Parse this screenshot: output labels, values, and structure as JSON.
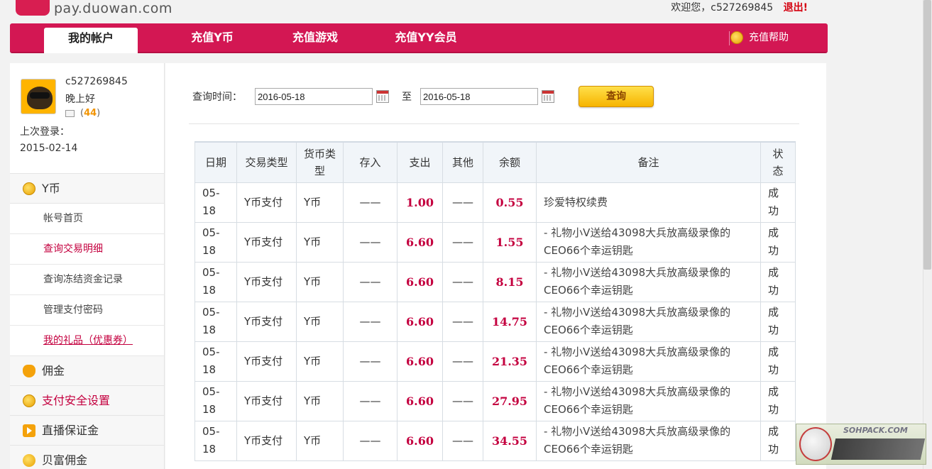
{
  "header": {
    "site": "pay.duowan.com",
    "welcome": "欢迎您，c527269845",
    "logout": "退出!"
  },
  "nav": {
    "tabs": [
      "我的帐户",
      "充值Y币",
      "充值游戏",
      "充值YY会员"
    ],
    "help": "充值帮助"
  },
  "profile": {
    "username": "c527269845",
    "greeting": "晚上好",
    "mail_prefix": "(",
    "mail_count": "44",
    "mail_suffix": ")",
    "last_login_label": "上次登录：",
    "last_login_date": "2015-02-14"
  },
  "sidebar": {
    "group_ycoin": "Y币",
    "items": [
      "帐号首页",
      "查询交易明细",
      "查询冻结资金记录",
      "管理支付密码",
      "我的礼品（优惠券）"
    ],
    "group_commission": "佣金",
    "group_security": "支付安全设置",
    "group_deposit": "直播保证金",
    "group_beifu": "贝富佣金"
  },
  "query": {
    "label": "查询时间：",
    "start_date": "2016-05-18",
    "to": "至",
    "end_date": "2016-05-18",
    "button": "查询"
  },
  "table": {
    "headers": [
      "日期",
      "交易类型",
      "货币类型",
      "存入",
      "支出",
      "其他",
      "余额",
      "备注",
      "状态"
    ],
    "rows": [
      {
        "date": "05-18",
        "type": "Y币支付",
        "currency": "Y币",
        "deposit": "——",
        "expense": "1.00",
        "other": "——",
        "balance": "0.55",
        "note": "珍爱特权续费",
        "status": "成功"
      },
      {
        "date": "05-18",
        "type": "Y币支付",
        "currency": "Y币",
        "deposit": "——",
        "expense": "6.60",
        "other": "——",
        "balance": "1.55",
        "note": "- 礼物小V送给43098大兵放高级录像的CEO66个幸运钥匙",
        "status": "成功"
      },
      {
        "date": "05-18",
        "type": "Y币支付",
        "currency": "Y币",
        "deposit": "——",
        "expense": "6.60",
        "other": "——",
        "balance": "8.15",
        "note": "- 礼物小V送给43098大兵放高级录像的CEO66个幸运钥匙",
        "status": "成功"
      },
      {
        "date": "05-18",
        "type": "Y币支付",
        "currency": "Y币",
        "deposit": "——",
        "expense": "6.60",
        "other": "——",
        "balance": "14.75",
        "note": "- 礼物小V送给43098大兵放高级录像的CEO66个幸运钥匙",
        "status": "成功"
      },
      {
        "date": "05-18",
        "type": "Y币支付",
        "currency": "Y币",
        "deposit": "——",
        "expense": "6.60",
        "other": "——",
        "balance": "21.35",
        "note": "- 礼物小V送给43098大兵放高级录像的CEO66个幸运钥匙",
        "status": "成功"
      },
      {
        "date": "05-18",
        "type": "Y币支付",
        "currency": "Y币",
        "deposit": "——",
        "expense": "6.60",
        "other": "——",
        "balance": "27.95",
        "note": "- 礼物小V送给43098大兵放高级录像的CEO66个幸运钥匙",
        "status": "成功"
      },
      {
        "date": "05-18",
        "type": "Y币支付",
        "currency": "Y币",
        "deposit": "——",
        "expense": "6.60",
        "other": "——",
        "balance": "34.55",
        "note": "- 礼物小V送给43098大兵放高级录像的CEO66个幸运钥匙",
        "status": "成功"
      }
    ]
  },
  "watermark": {
    "text": "SOHPACK.COM"
  },
  "colors": {
    "brand": "#d31753",
    "accent_text": "#c4003f",
    "button": "#f6b400"
  }
}
